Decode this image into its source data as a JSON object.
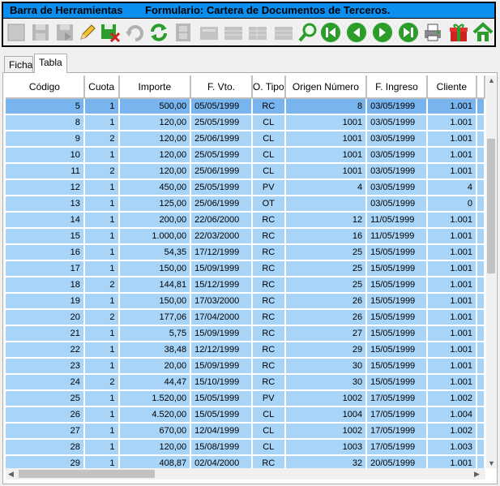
{
  "window": {
    "title_left": "Barra de Herramientas",
    "title_right": "Formulario: Cartera de Documentos de Terceros."
  },
  "toolbar": {
    "buttons": [
      {
        "name": "first-disabled-button",
        "icon": "blank-doc-icon",
        "enabled": false
      },
      {
        "name": "save-disabled-button",
        "icon": "floppy-icon",
        "enabled": false
      },
      {
        "name": "save-as-disabled-button",
        "icon": "floppy-arrow-icon",
        "enabled": false
      },
      {
        "name": "edit-button",
        "icon": "pencil-icon",
        "enabled": true
      },
      {
        "name": "delete-button",
        "icon": "floppy-delete-icon",
        "enabled": true
      },
      {
        "name": "undo-disabled-button",
        "icon": "undo-icon",
        "enabled": false
      },
      {
        "name": "refresh-button",
        "icon": "refresh-icon",
        "enabled": true
      },
      {
        "name": "film-disabled-button",
        "icon": "film-icon",
        "enabled": false
      },
      {
        "name": "form-disabled-button",
        "icon": "form-icon",
        "enabled": false
      },
      {
        "name": "grid-disabled-button",
        "icon": "grid-icon",
        "enabled": false
      },
      {
        "name": "grid2-disabled-button",
        "icon": "grid2-icon",
        "enabled": false
      },
      {
        "name": "search-button",
        "icon": "magnifier-icon",
        "enabled": true
      },
      {
        "name": "first-record-button",
        "icon": "first-icon",
        "enabled": true
      },
      {
        "name": "prev-record-button",
        "icon": "prev-icon",
        "enabled": true
      },
      {
        "name": "next-record-button",
        "icon": "next-icon",
        "enabled": true
      },
      {
        "name": "last-record-button",
        "icon": "last-icon",
        "enabled": true
      },
      {
        "name": "print-button",
        "icon": "printer-icon",
        "enabled": true
      },
      {
        "name": "gift-button",
        "icon": "gift-icon",
        "enabled": true
      },
      {
        "name": "home-button",
        "icon": "home-icon",
        "enabled": true
      }
    ]
  },
  "tabs": [
    {
      "label": "Ficha",
      "active": false
    },
    {
      "label": "Tabla",
      "active": true
    }
  ],
  "table": {
    "columns": [
      "Código",
      "Cuota",
      "Importe",
      "F. Vto.",
      "O. Tipo",
      "Origen Número",
      "F. Ingreso",
      "Cliente",
      ""
    ],
    "rows": [
      {
        "codigo": "5",
        "cuota": "1",
        "importe": "500,00",
        "fvto": "05/05/1999",
        "otipo": "RC",
        "origen": "8",
        "fingreso": "03/05/1999",
        "cliente": "1.001",
        "selected": true
      },
      {
        "codigo": "8",
        "cuota": "1",
        "importe": "120,00",
        "fvto": "25/05/1999",
        "otipo": "CL",
        "origen": "1001",
        "fingreso": "03/05/1999",
        "cliente": "1.001"
      },
      {
        "codigo": "9",
        "cuota": "2",
        "importe": "120,00",
        "fvto": "25/06/1999",
        "otipo": "CL",
        "origen": "1001",
        "fingreso": "03/05/1999",
        "cliente": "1.001"
      },
      {
        "codigo": "10",
        "cuota": "1",
        "importe": "120,00",
        "fvto": "25/05/1999",
        "otipo": "CL",
        "origen": "1001",
        "fingreso": "03/05/1999",
        "cliente": "1.001"
      },
      {
        "codigo": "11",
        "cuota": "2",
        "importe": "120,00",
        "fvto": "25/06/1999",
        "otipo": "CL",
        "origen": "1001",
        "fingreso": "03/05/1999",
        "cliente": "1.001"
      },
      {
        "codigo": "12",
        "cuota": "1",
        "importe": "450,00",
        "fvto": "25/05/1999",
        "otipo": "PV",
        "origen": "4",
        "fingreso": "03/05/1999",
        "cliente": "4"
      },
      {
        "codigo": "13",
        "cuota": "1",
        "importe": "125,00",
        "fvto": "25/06/1999",
        "otipo": "OT",
        "origen": "",
        "fingreso": "03/05/1999",
        "cliente": "0"
      },
      {
        "codigo": "14",
        "cuota": "1",
        "importe": "200,00",
        "fvto": "22/06/2000",
        "otipo": "RC",
        "origen": "12",
        "fingreso": "11/05/1999",
        "cliente": "1.001"
      },
      {
        "codigo": "15",
        "cuota": "1",
        "importe": "1.000,00",
        "fvto": "22/03/2000",
        "otipo": "RC",
        "origen": "16",
        "fingreso": "11/05/1999",
        "cliente": "1.001"
      },
      {
        "codigo": "16",
        "cuota": "1",
        "importe": "54,35",
        "fvto": "17/12/1999",
        "otipo": "RC",
        "origen": "25",
        "fingreso": "15/05/1999",
        "cliente": "1.001"
      },
      {
        "codigo": "17",
        "cuota": "1",
        "importe": "150,00",
        "fvto": "15/09/1999",
        "otipo": "RC",
        "origen": "25",
        "fingreso": "15/05/1999",
        "cliente": "1.001"
      },
      {
        "codigo": "18",
        "cuota": "2",
        "importe": "144,81",
        "fvto": "15/12/1999",
        "otipo": "RC",
        "origen": "25",
        "fingreso": "15/05/1999",
        "cliente": "1.001"
      },
      {
        "codigo": "19",
        "cuota": "1",
        "importe": "150,00",
        "fvto": "17/03/2000",
        "otipo": "RC",
        "origen": "26",
        "fingreso": "15/05/1999",
        "cliente": "1.001"
      },
      {
        "codigo": "20",
        "cuota": "2",
        "importe": "177,06",
        "fvto": "17/04/2000",
        "otipo": "RC",
        "origen": "26",
        "fingreso": "15/05/1999",
        "cliente": "1.001"
      },
      {
        "codigo": "21",
        "cuota": "1",
        "importe": "5,75",
        "fvto": "15/09/1999",
        "otipo": "RC",
        "origen": "27",
        "fingreso": "15/05/1999",
        "cliente": "1.001"
      },
      {
        "codigo": "22",
        "cuota": "1",
        "importe": "38,48",
        "fvto": "12/12/1999",
        "otipo": "RC",
        "origen": "29",
        "fingreso": "15/05/1999",
        "cliente": "1.001"
      },
      {
        "codigo": "23",
        "cuota": "1",
        "importe": "20,00",
        "fvto": "15/09/1999",
        "otipo": "RC",
        "origen": "30",
        "fingreso": "15/05/1999",
        "cliente": "1.001"
      },
      {
        "codigo": "24",
        "cuota": "2",
        "importe": "44,47",
        "fvto": "15/10/1999",
        "otipo": "RC",
        "origen": "30",
        "fingreso": "15/05/1999",
        "cliente": "1.001"
      },
      {
        "codigo": "25",
        "cuota": "1",
        "importe": "1.520,00",
        "fvto": "15/05/1999",
        "otipo": "PV",
        "origen": "1002",
        "fingreso": "17/05/1999",
        "cliente": "1.002"
      },
      {
        "codigo": "26",
        "cuota": "1",
        "importe": "4.520,00",
        "fvto": "15/05/1999",
        "otipo": "CL",
        "origen": "1004",
        "fingreso": "17/05/1999",
        "cliente": "1.004"
      },
      {
        "codigo": "27",
        "cuota": "1",
        "importe": "670,00",
        "fvto": "12/04/1999",
        "otipo": "CL",
        "origen": "1002",
        "fingreso": "17/05/1999",
        "cliente": "1.002"
      },
      {
        "codigo": "28",
        "cuota": "1",
        "importe": "120,00",
        "fvto": "15/08/1999",
        "otipo": "CL",
        "origen": "1003",
        "fingreso": "17/05/1999",
        "cliente": "1.003"
      },
      {
        "codigo": "29",
        "cuota": "1",
        "importe": "408,87",
        "fvto": "02/04/2000",
        "otipo": "RC",
        "origen": "32",
        "fingreso": "20/05/1999",
        "cliente": "1.001"
      }
    ]
  },
  "colors": {
    "titlebar": "#0a8ef0",
    "row": "#a8d4f8",
    "row_selected": "#78b4ee",
    "icon_green": "#2a9d2a",
    "icon_red": "#d02020"
  }
}
